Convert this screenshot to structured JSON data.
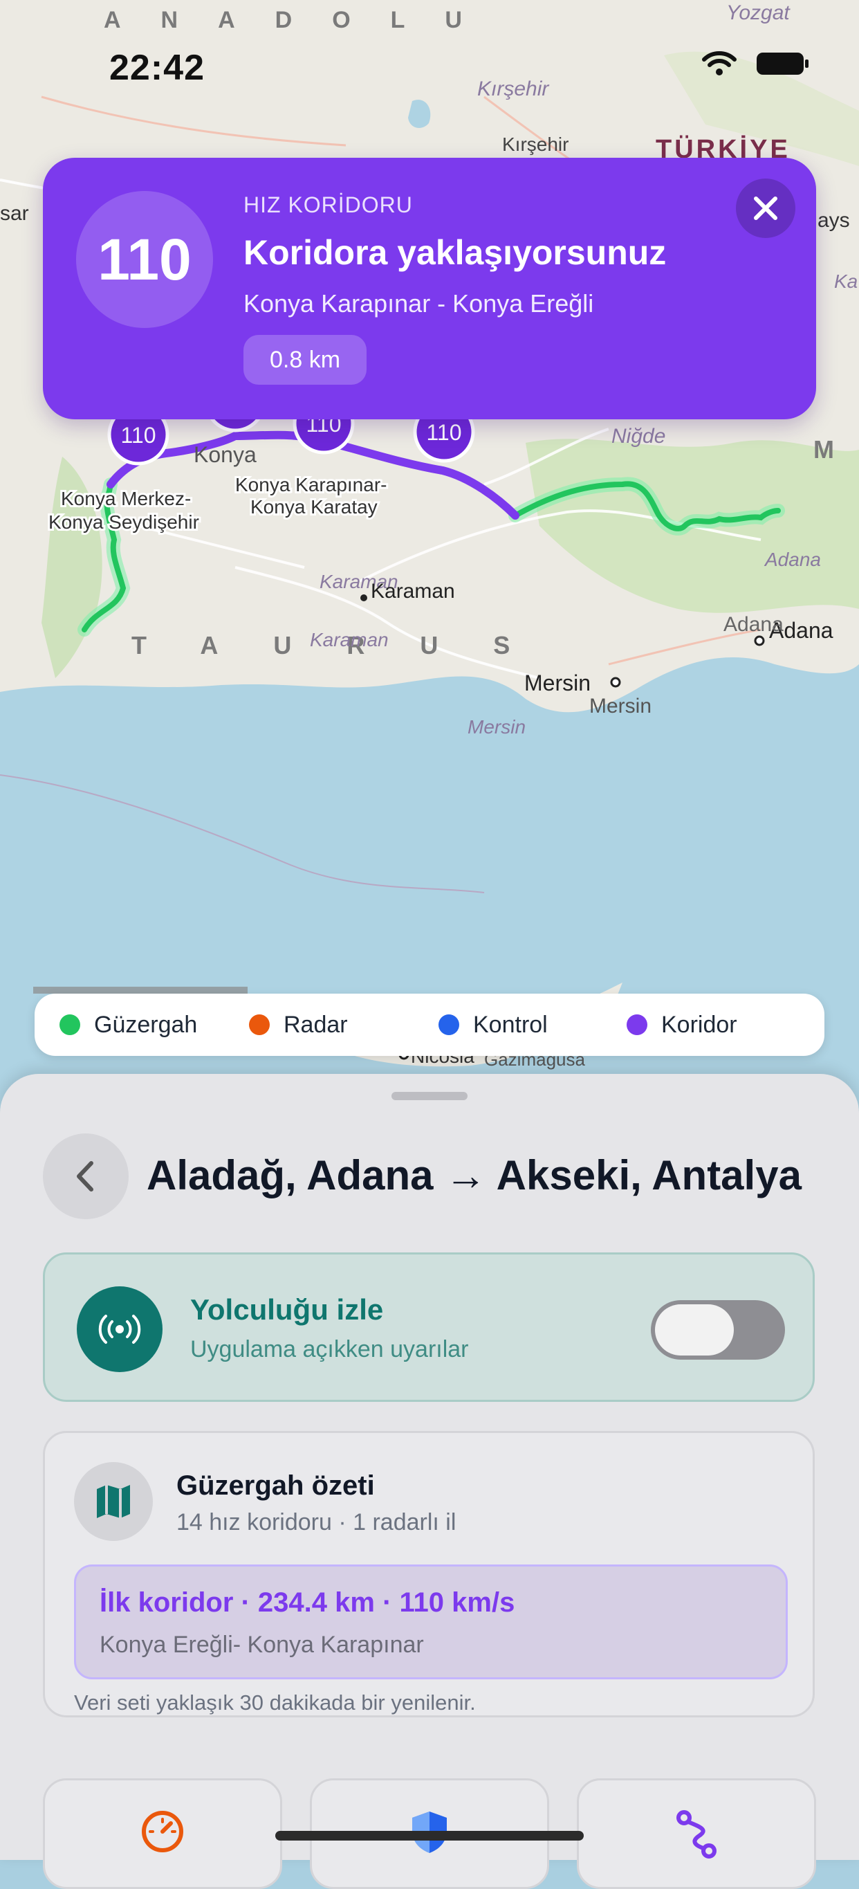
{
  "status_bar": {
    "time": "22:42"
  },
  "map": {
    "region_labels": [
      "ANADOLU",
      "TÜRKİYE",
      "TAURUS"
    ],
    "cities": [
      "Yozgat",
      "Kırşehir",
      "Kırşehir",
      "Niğde",
      "Karaman",
      "Karaman",
      "Karaman",
      "Mersin",
      "Mersin",
      "Mersin",
      "Adana",
      "Adana",
      "Adana",
      "Konya",
      "Nicosia",
      "Gazimagusa",
      "sar",
      "ays",
      "Ka"
    ],
    "segment_labels": [
      "Konya Merkez-",
      "Konya Seydişehir",
      "Konya Karapınar-",
      "Konya Karatay"
    ],
    "speed_markers": [
      "110",
      "110",
      "110",
      "110"
    ]
  },
  "alert": {
    "speed": "110",
    "kicker": "HIZ KORİDORU",
    "title": "Koridora yaklaşıyorsunuz",
    "subtitle": "Konya Karapınar - Konya Ereğli",
    "distance": "0.8 km"
  },
  "legend": [
    {
      "label": "Güzergah",
      "color": "#22c55e"
    },
    {
      "label": "Radar",
      "color": "#ea580c"
    },
    {
      "label": "Kontrol",
      "color": "#2563eb"
    },
    {
      "label": "Koridor",
      "color": "#7c3aed"
    }
  ],
  "sheet": {
    "title": "Aladağ, Adana → Akseki, Antalya",
    "track": {
      "title": "Yolculuğu izle",
      "subtitle": "Uygulama açıkken uyarılar",
      "enabled": false
    },
    "summary": {
      "title": "Güzergah özeti",
      "subtitle": "14 hız koridoru · 1 radarlı il",
      "first_corridor_title": "İlk koridor · 234.4 km · 110 km/s",
      "first_corridor_route": "Konya Ereğli- Konya Karapınar",
      "note": "Veri seti yaklaşık 30 dakikada bir yenilenir."
    },
    "tiles": [
      {
        "icon": "speedometer-icon",
        "color": "#ea580c"
      },
      {
        "icon": "shield-icon",
        "color": "#2563eb"
      },
      {
        "icon": "route-icon",
        "color": "#7c3aed"
      }
    ]
  }
}
